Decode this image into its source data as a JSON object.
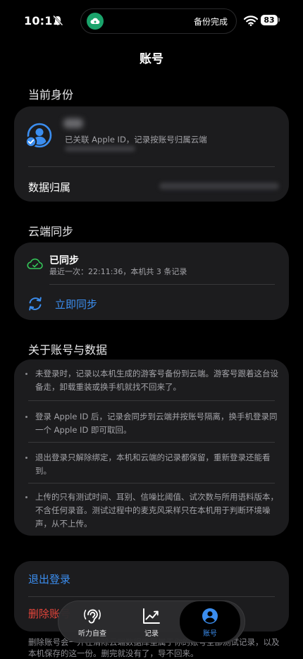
{
  "status": {
    "time": "10:11",
    "battery": "83",
    "island_text": "备份完成"
  },
  "nav": {
    "title": "账号"
  },
  "identity": {
    "header": "当前身份",
    "linked_text": "已关联 Apple ID，记录按账号归属云端",
    "data_owner_label": "数据归属"
  },
  "sync": {
    "header": "云端同步",
    "status": "已同步",
    "detail": "最近一次：22:11:36，本机共 3 条记录",
    "sync_now": "立即同步"
  },
  "about": {
    "header": "关于账号与数据",
    "items": [
      "未登录时，记录以本机生成的游客号备份到云端。游客号跟着这台设备走，卸载重装或换手机就找不回来了。",
      "登录 Apple ID 后，记录会同步到云端并按账号隔离，换手机登录同一个 Apple ID 即可取回。",
      "退出登录只解除绑定，本机和云端的记录都保留，重新登录还能看到。",
      "上传的只有测试时间、耳别、信噪比阈值、试次数与所用语料版本，不含任何录音。测试过程中的麦克风采样只在本机用于判断环境噪声，从不上传。"
    ]
  },
  "actions": {
    "logout": "退出登录",
    "delete": "删除账号",
    "footnote": "删除账号会一并在清除云端数据库里属于你的账号全部测试记录，以及本机保存的这一份。删完就没有了，导不回来。"
  },
  "tabs": [
    {
      "label": "听力自查",
      "icon": "hearing-icon"
    },
    {
      "label": "记录",
      "icon": "chart-icon"
    },
    {
      "label": "账号",
      "icon": "person-icon",
      "active": true
    }
  ],
  "colors": {
    "accent": "#3b8ef0",
    "danger": "#e5453b",
    "success": "#34c759",
    "card": "#1c1c1e"
  }
}
